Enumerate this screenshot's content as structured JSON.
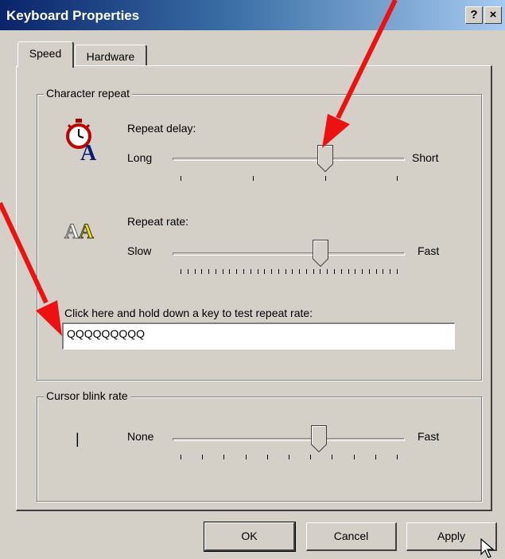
{
  "window": {
    "title": "Keyboard Properties",
    "help_btn": "?",
    "close_btn": "×"
  },
  "tabs": [
    {
      "label": "Speed",
      "active": true
    },
    {
      "label": "Hardware",
      "active": false
    }
  ],
  "character_repeat": {
    "group_label": "Character repeat",
    "repeat_delay": {
      "label": "Repeat delay:",
      "min_label": "Long",
      "max_label": "Short",
      "value_fraction": 0.667
    },
    "repeat_rate": {
      "label": "Repeat rate:",
      "min_label": "Slow",
      "max_label": "Fast",
      "value_fraction": 0.65
    },
    "test_label": "Click here and hold down a key to test repeat rate:",
    "test_value": "QQQQQQQQQ"
  },
  "cursor_blink": {
    "group_label": "Cursor blink rate",
    "cursor_glyph": "|",
    "min_label": "None",
    "max_label": "Fast",
    "value_fraction": 0.64
  },
  "buttons": {
    "ok": "OK",
    "cancel": "Cancel",
    "apply": "Apply"
  },
  "colors": {
    "face": "#d4d0c8",
    "title_start": "#0a246a",
    "annotation_arrow": "#ff0000"
  },
  "icons": [
    "stopwatch-letter-a-icon",
    "double-letter-a-icon",
    "mouse-cursor-icon"
  ]
}
